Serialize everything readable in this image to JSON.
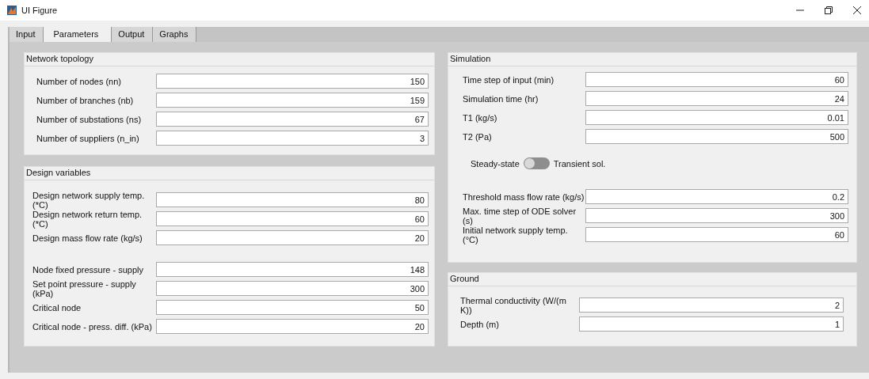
{
  "window": {
    "title": "UI Figure"
  },
  "tabs": [
    {
      "label": "Input",
      "selected": false
    },
    {
      "label": "Parameters",
      "selected": true
    },
    {
      "label": "Output",
      "selected": false
    },
    {
      "label": "Graphs",
      "selected": false
    }
  ],
  "panels": [
    {
      "title": "Network topology",
      "groups": [
        {
          "kind": "fields",
          "fields": [
            {
              "label": "Number of nodes (nn)",
              "value": "150"
            },
            {
              "label": "Number of branches (nb)",
              "value": "159"
            },
            {
              "label": "Number of substations (ns)",
              "value": "67"
            },
            {
              "label": "Number of suppliers (n_in)",
              "value": "3"
            }
          ]
        }
      ]
    },
    {
      "title": "Design variables",
      "groups": [
        {
          "kind": "fields",
          "fields": [
            {
              "label": "Design network supply temp. (*C)",
              "value": "80"
            },
            {
              "label": "Design network return temp. (*C)",
              "value": "60"
            },
            {
              "label": "Design mass flow rate (kg/s)",
              "value": "20"
            }
          ]
        },
        {
          "kind": "fields",
          "fields": [
            {
              "label": "Node fixed pressure - supply",
              "value": "148"
            },
            {
              "label": "Set point pressure - supply (kPa)",
              "value": "300"
            },
            {
              "label": "Critical node",
              "value": "50"
            },
            {
              "label": "Critical node - press. diff. (kPa)",
              "value": "20"
            }
          ]
        }
      ]
    },
    {
      "title": "Simulation",
      "groups": [
        {
          "kind": "fields",
          "fields": [
            {
              "label": "Time step of input (min)",
              "value": "60"
            },
            {
              "label": "Simulation time (hr)",
              "value": "24"
            },
            {
              "label": "T1 (kg/s)",
              "value": "0.01"
            },
            {
              "label": "T2 (Pa)",
              "value": "500"
            }
          ]
        },
        {
          "kind": "switch",
          "off_label": "Steady-state",
          "on_label": "Transient sol.",
          "on": false
        },
        {
          "kind": "fields",
          "fields": [
            {
              "label": "Threshold mass flow rate (kg/s)",
              "value": "0.2"
            },
            {
              "label": "Max. time step of ODE solver (s)",
              "value": "300"
            },
            {
              "label": "Initial network supply temp. (°C)",
              "value": "60"
            }
          ]
        }
      ]
    },
    {
      "title": "Ground",
      "groups": [
        {
          "kind": "fields",
          "fields": [
            {
              "label": "Thermal conductivity (W/(m K))",
              "value": "2"
            },
            {
              "label": "Depth (m)",
              "value": "1"
            }
          ]
        }
      ]
    }
  ]
}
